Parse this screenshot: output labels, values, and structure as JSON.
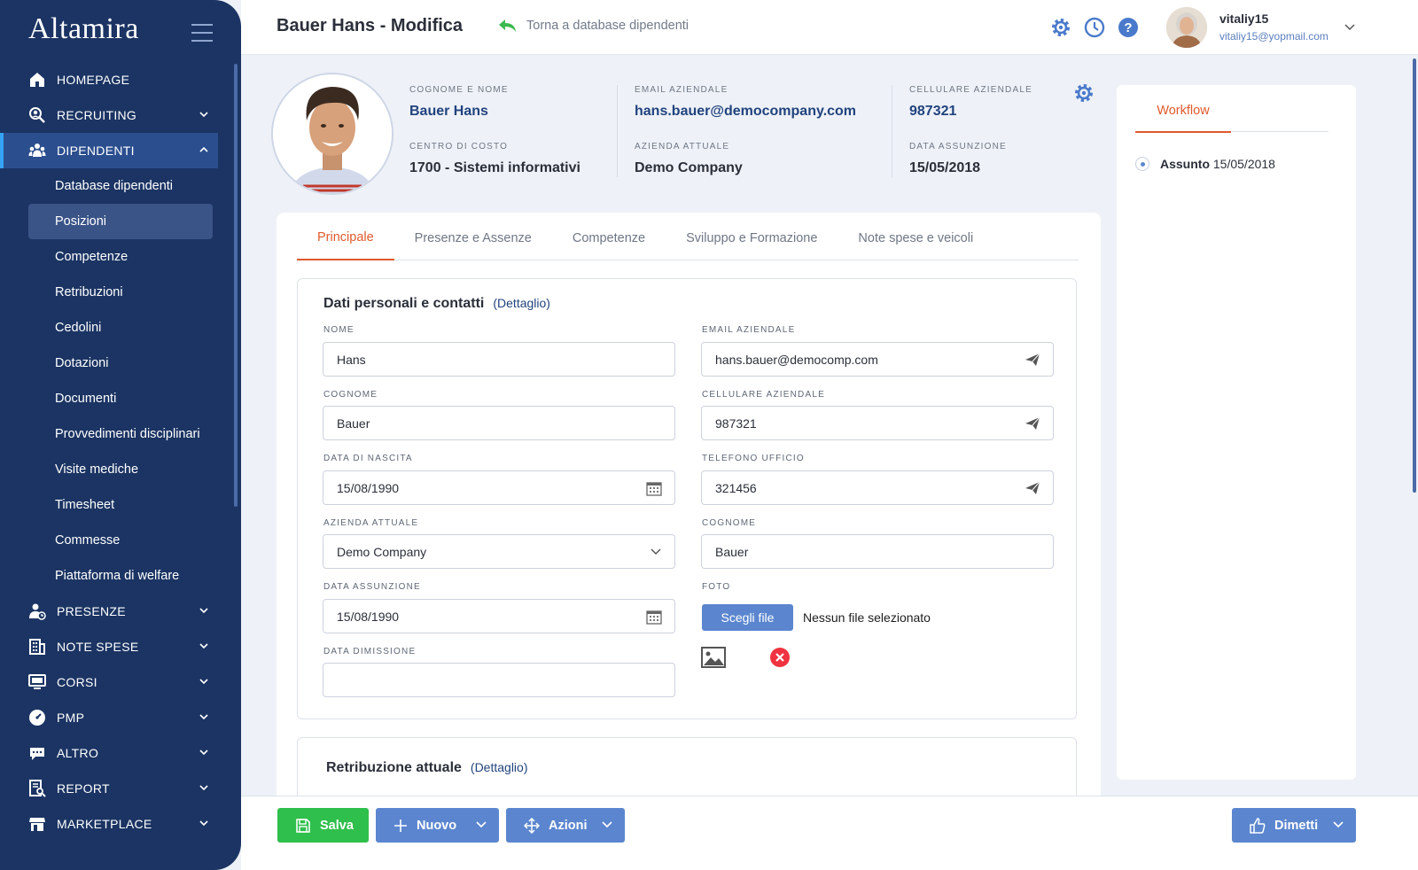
{
  "app": {
    "logo": "Altamira"
  },
  "sidebar": {
    "items": [
      {
        "label": "HOMEPAGE",
        "icon": "home-icon"
      },
      {
        "label": "RECRUITING",
        "icon": "recruiting-icon"
      },
      {
        "label": "DIPENDENTI",
        "icon": "users-icon"
      },
      {
        "label": "PRESENZE",
        "icon": "presence-icon"
      },
      {
        "label": "NOTE SPESE",
        "icon": "building-icon"
      },
      {
        "label": "CORSI",
        "icon": "courses-icon"
      },
      {
        "label": "PMP",
        "icon": "gauge-icon"
      },
      {
        "label": "ALTRO",
        "icon": "chat-icon"
      },
      {
        "label": "REPORT",
        "icon": "report-icon"
      },
      {
        "label": "MARKETPLACE",
        "icon": "store-icon"
      }
    ],
    "subitems": [
      "Database dipendenti",
      "Posizioni",
      "Competenze",
      "Retribuzioni",
      "Cedolini",
      "Dotazioni",
      "Documenti",
      "Provvedimenti disciplinari",
      "Visite mediche",
      "Timesheet",
      "Commesse",
      "Piattaforma di welfare"
    ]
  },
  "header": {
    "title": "Bauer Hans - Modifica",
    "back_label": "Torna a database dipendenti",
    "user_name": "vitaliy15",
    "user_email": "vitaliy15@yopmail.com"
  },
  "profile": {
    "name_label": "COGNOME E NOME",
    "name": "Bauer Hans",
    "email_label": "EMAIL AZIENDALE",
    "email": "hans.bauer@democompany.com",
    "phone_label": "CELLULARE AZIENDALE",
    "phone": "987321",
    "cost_label": "CENTRO DI COSTO",
    "cost": "1700 - Sistemi informativi",
    "company_label": "AZIENDA ATTUALE",
    "company": "Demo Company",
    "hire_label": "DATA ASSUNZIONE",
    "hire": "15/05/2018"
  },
  "tabs": [
    "Principale",
    "Presenze e Assenze",
    "Competenze",
    "Sviluppo e Formazione",
    "Note spese e veicoli"
  ],
  "form": {
    "title": "Dati personali e contatti",
    "detail": "(Dettaglio)",
    "nome_label": "NOME",
    "nome": "Hans",
    "cognome_label": "COGNOME",
    "cognome": "Bauer",
    "nascita_label": "DATA DI NASCITA",
    "nascita": "15/08/1990",
    "azienda_label": "AZIENDA ATTUALE",
    "azienda": "Demo Company",
    "assunzione_label": "DATA ASSUNZIONE",
    "assunzione": "15/08/1990",
    "dimissione_label": "DATA DIMISSIONE",
    "dimissione": "",
    "email_label": "EMAIL AZIENDALE",
    "email": "hans.bauer@democomp.com",
    "cell_label": "CELLULARE AZIENDALE",
    "cell": "987321",
    "tel_label": "TELEFONO UFFICIO",
    "tel": "321456",
    "cognome2_label": "COGNOME",
    "cognome2": "Bauer",
    "foto_label": "FOTO",
    "choose_file": "Scegli file",
    "no_file": "Nessun file selezionato"
  },
  "form2": {
    "title": "Retribuzione attuale",
    "detail": "(Dettaglio)"
  },
  "workflow": {
    "tab": "Workflow",
    "status": "Assunto",
    "date": "15/05/2018"
  },
  "actions": {
    "save": "Salva",
    "new": "Nuovo",
    "actions": "Azioni",
    "resign": "Dimetti"
  },
  "colors": {
    "sidebar": "#1b3463",
    "accent": "#e05a2b",
    "primary": "#5b86cf",
    "success": "#2fbf4c"
  }
}
